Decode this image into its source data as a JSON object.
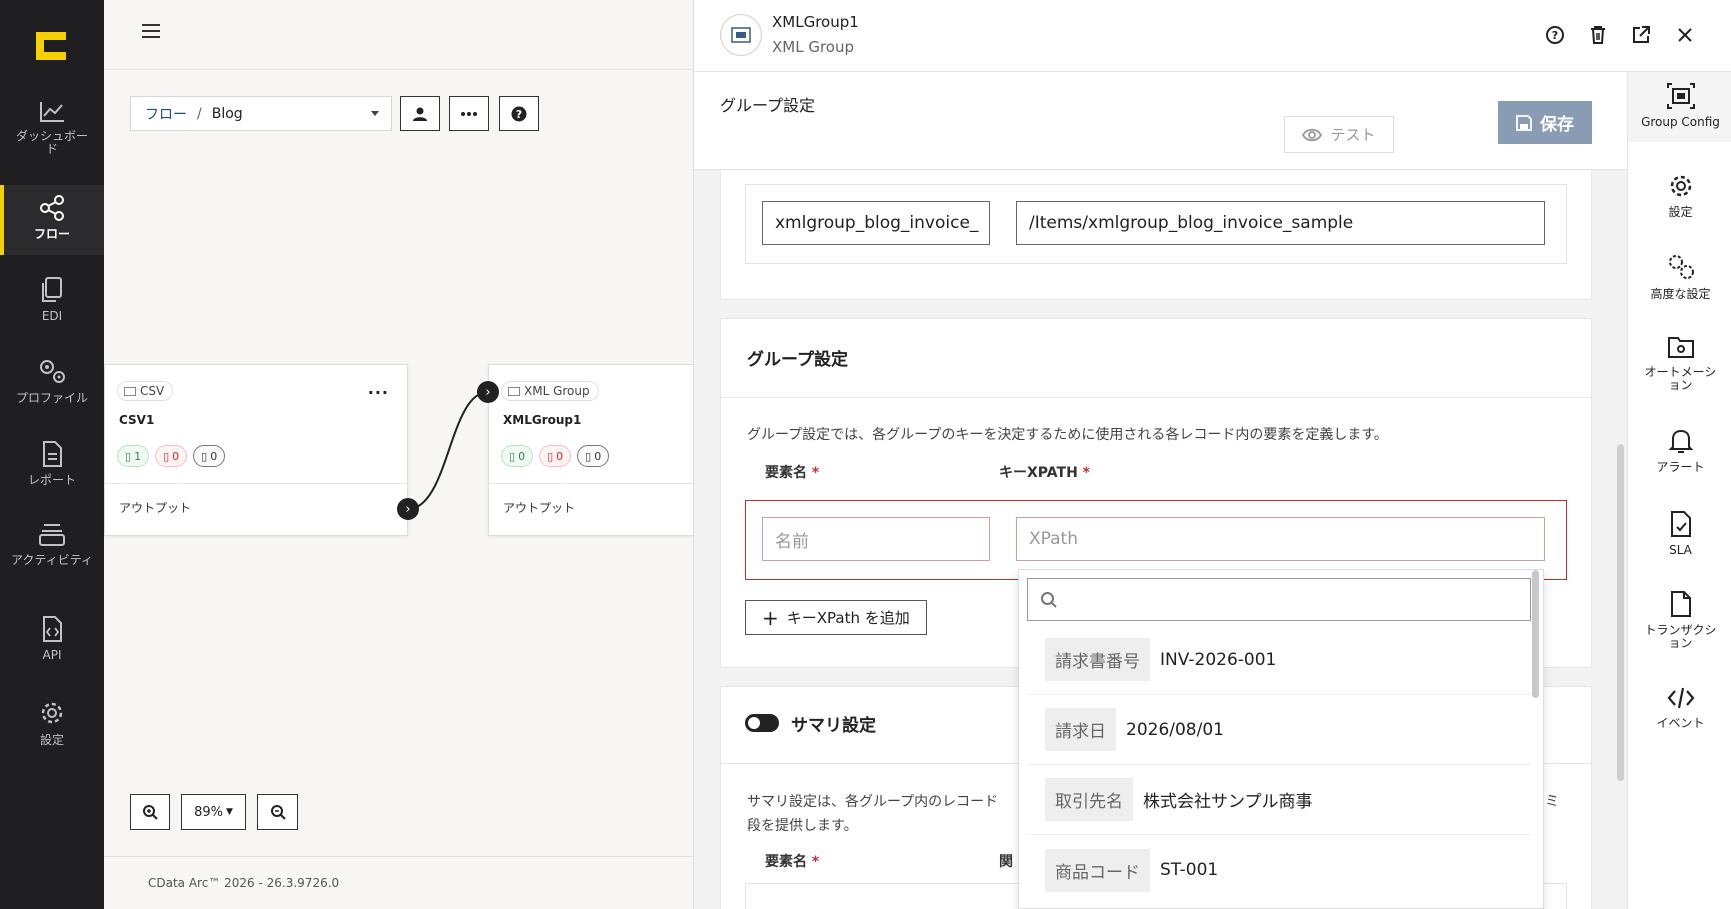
{
  "nav": {
    "items": [
      {
        "label": "ダッシュボード"
      },
      {
        "label": "フロー"
      },
      {
        "label": "EDI"
      },
      {
        "label": "プロファイル"
      },
      {
        "label": "レポート"
      },
      {
        "label": "アクティビティ"
      },
      {
        "label": "API"
      },
      {
        "label": "設定"
      }
    ]
  },
  "canvas": {
    "breadcrumb": {
      "root": "フロー",
      "separator": "/",
      "current": "Blog"
    },
    "nodes": [
      {
        "type": "CSV",
        "name": "CSV1",
        "stats": [
          "1",
          "0",
          "0"
        ],
        "output": "アウトプット"
      },
      {
        "type": "XML Group",
        "name": "XMLGroup1",
        "stats": [
          "0",
          "0",
          "0"
        ],
        "output": "アウトプット"
      }
    ],
    "zoom": "89%",
    "copyright": "CData Arc™ 2026 - 26.3.9726.0"
  },
  "panel": {
    "title": "XMLGroup1",
    "subtitle": "XML Group",
    "section_title": "グループ設定",
    "test_label": "テスト",
    "save_label": "保存",
    "top_fields": {
      "name_value": "xmlgroup_blog_invoice_",
      "xpath_value": "/Items/xmlgroup_blog_invoice_sample"
    },
    "group": {
      "title": "グループ設定",
      "description": "グループ設定では、各グループのキーを決定するために使用される各レコード内の要素を定義します。",
      "col_name": "要素名",
      "col_xpath": "キーXPATH",
      "required": "*",
      "name_placeholder": "名前",
      "xpath_placeholder": "XPath",
      "add_label": "キーXPath を追加"
    },
    "summary": {
      "title": "サマリ設定",
      "description_line1": "サマリ設定は、各グループ内のレコード",
      "description_tail": "ミ",
      "description_line2": "段を提供します。",
      "col_name": "要素名",
      "col_partial": "関"
    },
    "dropdown": {
      "items": [
        {
          "key": "請求書番号",
          "value": "INV-2026-001"
        },
        {
          "key": "請求日",
          "value": "2026/08/01"
        },
        {
          "key": "取引先名",
          "value": "株式会社サンプル商事"
        },
        {
          "key": "商品コード",
          "value": "ST-001"
        }
      ]
    },
    "tabs": [
      {
        "label": "Group Config"
      },
      {
        "label": "設定"
      },
      {
        "label": "高度な設定"
      },
      {
        "label": "オートメーション"
      },
      {
        "label": "アラート"
      },
      {
        "label": "SLA"
      },
      {
        "label": "トランザクション"
      },
      {
        "label": "イベント"
      }
    ]
  },
  "colors": {
    "accent": "#f5d000",
    "save": "#8a9bb4",
    "sidebar": "#1f1f21",
    "required": "#c62f2f"
  }
}
